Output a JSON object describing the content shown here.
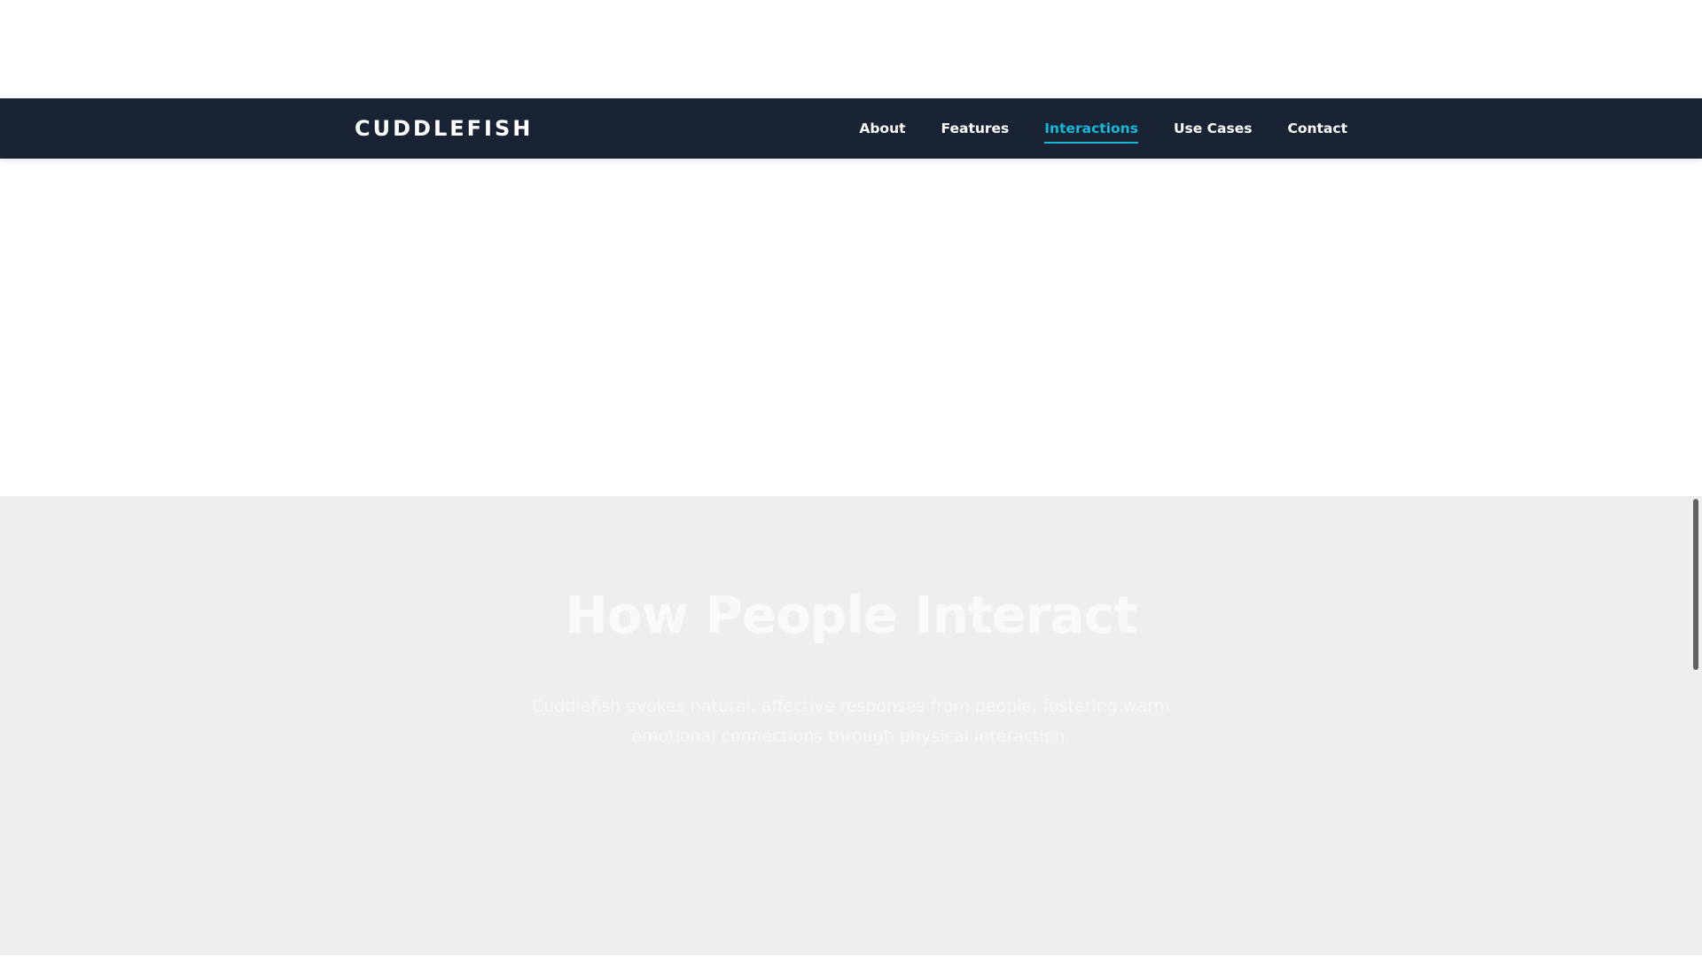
{
  "brand": {
    "name": "CUDDLEFISH"
  },
  "nav": {
    "items": [
      {
        "label": "About"
      },
      {
        "label": "Features"
      },
      {
        "label": "Interactions",
        "active": true
      },
      {
        "label": "Use Cases"
      },
      {
        "label": "Contact"
      }
    ]
  },
  "interactions": {
    "title": "How People Interact",
    "description": "Cuddlefish evokes natural, affective responses from people, fostering warm emotional connections through physical interaction."
  },
  "colors": {
    "navbar_bg": "#1a2334",
    "accent": "#17b7d8",
    "section_bg": "#eceef0"
  }
}
